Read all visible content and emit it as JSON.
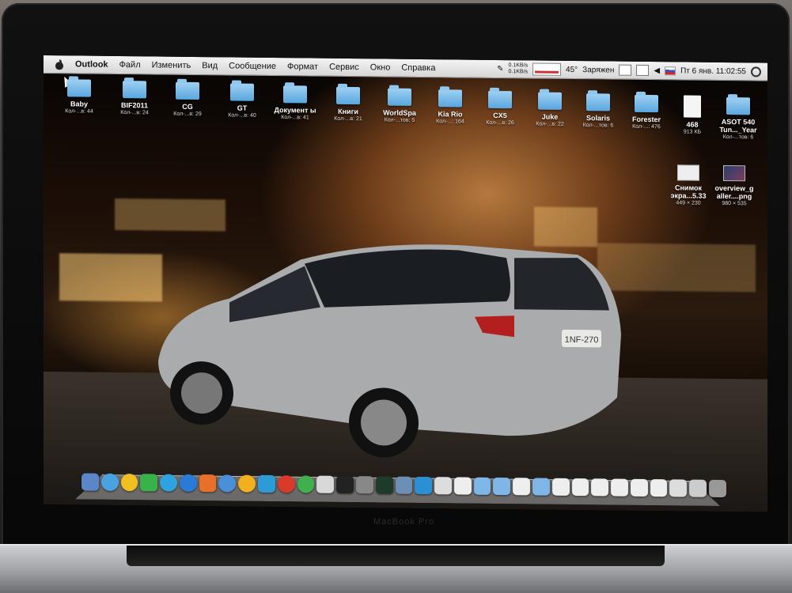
{
  "menubar": {
    "app_name": "Outlook",
    "menus": [
      "Файл",
      "Изменить",
      "Вид",
      "Сообщение",
      "Формат",
      "Сервис",
      "Окно",
      "Справка"
    ],
    "status": {
      "net_up": "0.1KB/s",
      "net_down": "0.1KB/s",
      "temperature": "45°",
      "battery": "Заряжен",
      "datetime": "Пт 6 янв.  11:02:55"
    }
  },
  "desktop_icons": [
    {
      "name": "Baby",
      "info": "Кол-...в: 44",
      "kind": "folder"
    },
    {
      "name": "BIF2011",
      "info": "Кол-...в: 24",
      "kind": "folder"
    },
    {
      "name": "CG",
      "info": "Кол-...в: 29",
      "kind": "folder"
    },
    {
      "name": "GT",
      "info": "Кол-...в: 40",
      "kind": "folder"
    },
    {
      "name": "Документ ы",
      "info": "Кол-...в: 41",
      "kind": "folder"
    },
    {
      "name": "Книги",
      "info": "Кол-...в: 21",
      "kind": "folder"
    },
    {
      "name": "WorldSpa",
      "info": "Кол-...тов: 5",
      "kind": "folder"
    },
    {
      "name": "Kia Rio",
      "info": "Кол-...: 164",
      "kind": "folder"
    },
    {
      "name": "CX5",
      "info": "Кол-...в: 26",
      "kind": "folder"
    },
    {
      "name": "Juke",
      "info": "Кол-...в: 22",
      "kind": "folder"
    },
    {
      "name": "Solaris",
      "info": "Кол-...тов: 6",
      "kind": "folder"
    },
    {
      "name": "Forester",
      "info": "Кол-...: 476",
      "kind": "folder"
    },
    {
      "name": "468",
      "info": "913 КБ",
      "kind": "document"
    },
    {
      "name": "ASOT 540 Tun..._Year",
      "info": "Кол-...тов: 6",
      "kind": "folder"
    },
    {
      "name": "Снимок экра...5.33",
      "info": "449 × 230",
      "kind": "image"
    },
    {
      "name": "overview_g aller....png",
      "info": "980 × 535",
      "kind": "image"
    }
  ],
  "dock": {
    "item_count": 33
  },
  "bezel_label": "MacBook Pro",
  "license_plate": "1NF-270",
  "colors": {
    "folder": "#6cb4e8",
    "menubar": "#e4e4e4",
    "wallpaper_glow": "#b5793e"
  }
}
